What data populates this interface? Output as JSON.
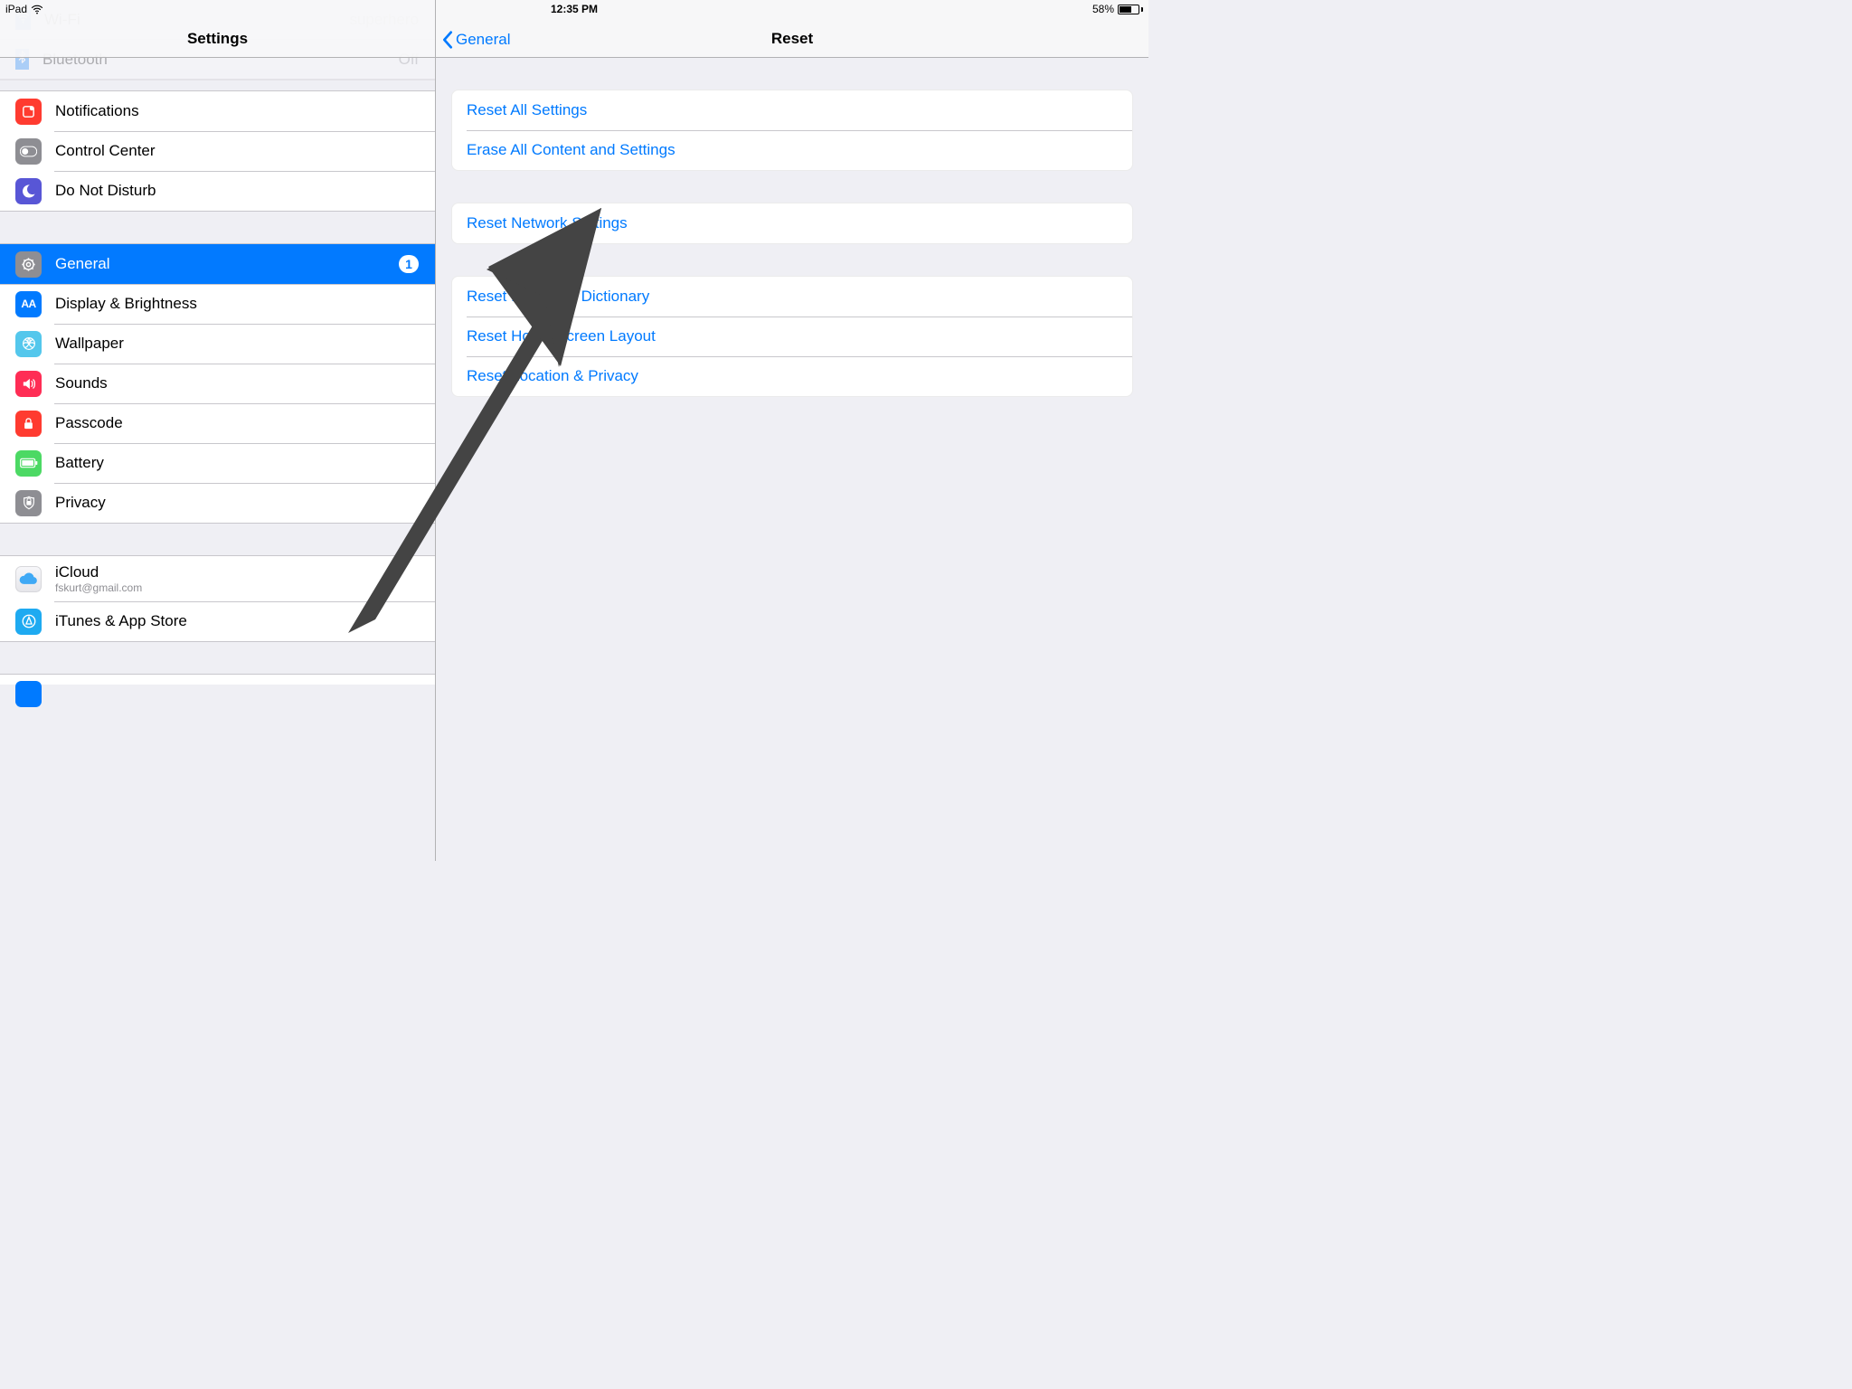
{
  "statusbar": {
    "device": "iPad",
    "time": "12:35 PM",
    "battery_pct": "58%"
  },
  "left": {
    "title": "Settings",
    "ghost": {
      "wifi_label": "Wi-Fi",
      "wifi_value": "superhero",
      "bt_label": "Bluetooth",
      "bt_value": "Off"
    },
    "groupA": {
      "notifications": "Notifications",
      "control_center": "Control Center",
      "dnd": "Do Not Disturb"
    },
    "groupB": {
      "general": "General",
      "general_badge": "1",
      "display": "Display & Brightness",
      "wallpaper": "Wallpaper",
      "sounds": "Sounds",
      "passcode": "Passcode",
      "battery": "Battery",
      "privacy": "Privacy"
    },
    "groupC": {
      "icloud": "iCloud",
      "icloud_sub": "fskurt@gmail.com",
      "itunes": "iTunes & App Store"
    }
  },
  "right": {
    "back_label": "General",
    "title": "Reset",
    "g1": {
      "reset_all": "Reset All Settings",
      "erase_all": "Erase All Content and Settings"
    },
    "g2": {
      "reset_network": "Reset Network Settings"
    },
    "g3": {
      "reset_keyboard": "Reset Keyboard Dictionary",
      "reset_home": "Reset Home Screen Layout",
      "reset_location": "Reset Location & Privacy"
    }
  }
}
